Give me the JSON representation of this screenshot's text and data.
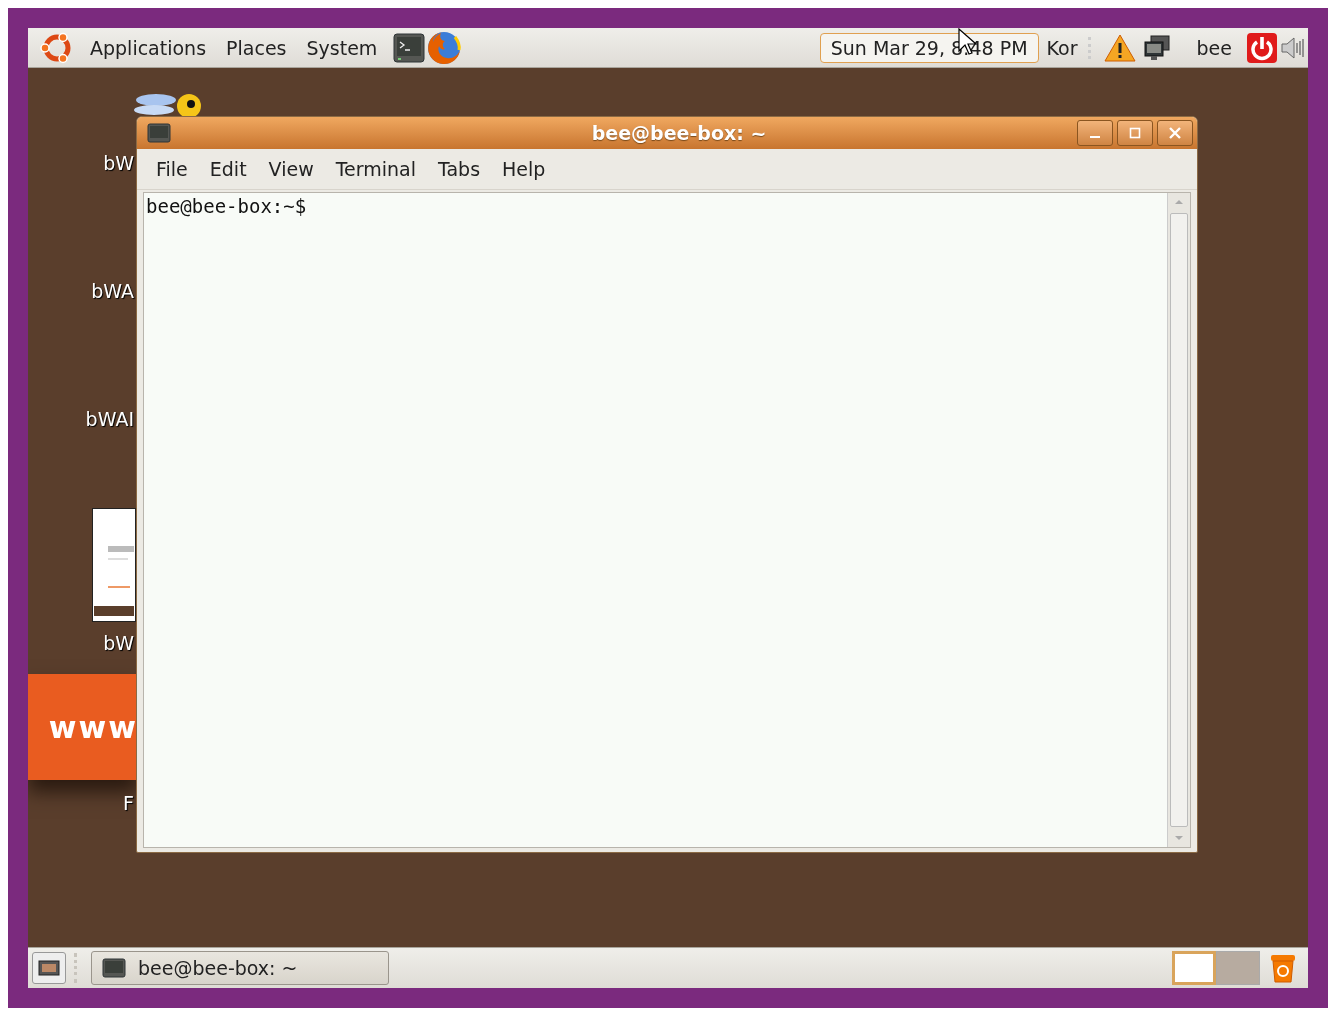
{
  "top_panel": {
    "menus": [
      {
        "label": "Applications"
      },
      {
        "label": "Places"
      },
      {
        "label": "System"
      }
    ],
    "clock": "Sun Mar 29,  8:48 PM",
    "keyboard": "Kor",
    "user": "bee"
  },
  "desktop": {
    "icons": [
      {
        "kind": "app",
        "label": "bW"
      },
      {
        "kind": "app",
        "label": "bWA"
      },
      {
        "kind": "app",
        "label": "bWAI"
      },
      {
        "kind": "document",
        "label": "bW"
      },
      {
        "kind": "banner",
        "label": "F",
        "banner_text": "www"
      }
    ]
  },
  "window": {
    "title": "bee@bee-box: ~",
    "menus": [
      {
        "label": "File"
      },
      {
        "label": "Edit"
      },
      {
        "label": "View"
      },
      {
        "label": "Terminal"
      },
      {
        "label": "Tabs"
      },
      {
        "label": "Help"
      }
    ],
    "prompt": "bee@bee-box:~$"
  },
  "bottom_panel": {
    "tasks": [
      {
        "label": "bee@bee-box: ~",
        "selected": false
      }
    ],
    "workspaces": [
      {
        "selected": true
      },
      {
        "selected": false
      }
    ]
  }
}
